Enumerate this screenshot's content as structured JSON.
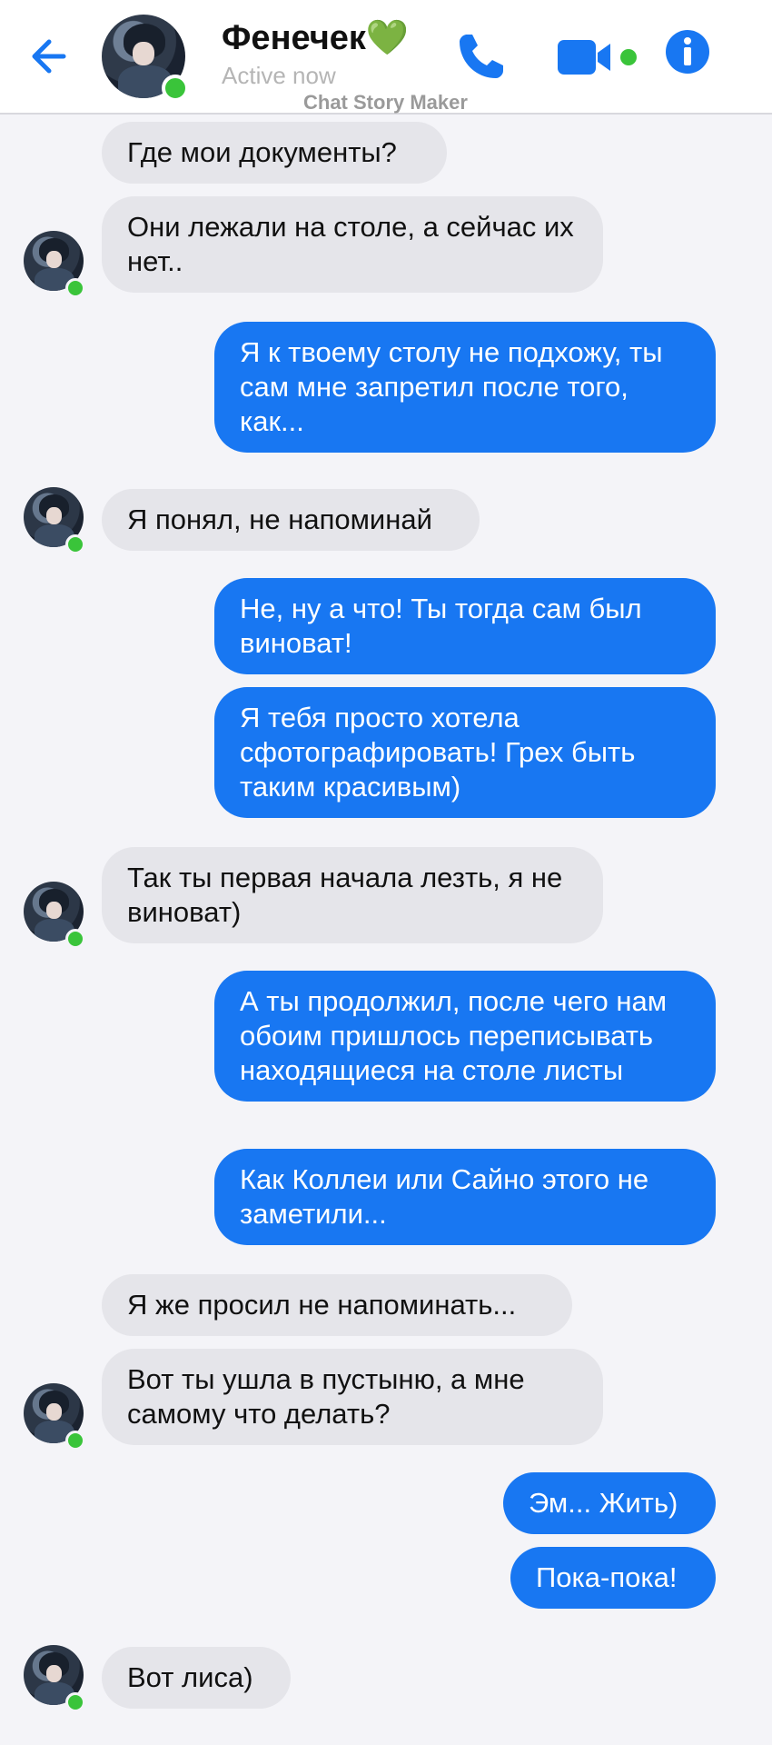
{
  "header": {
    "name": "Фенечек",
    "heart": "💚",
    "status": "Active now",
    "watermark": "Chat Story Maker",
    "accent_color": "#1877f2",
    "online_color": "#3ac43a"
  },
  "messages": [
    {
      "side": "in",
      "text": "Где мои документы?"
    },
    {
      "side": "in",
      "text": "Они лежали на столе, а сейчас их нет.."
    },
    {
      "side": "out",
      "text": "Я к твоему столу не подхожу, ты сам мне запретил после того, как..."
    },
    {
      "side": "in",
      "text": "Я понял, не напоминай"
    },
    {
      "side": "out",
      "text": "Не, ну а что! Ты тогда сам был виноват!"
    },
    {
      "side": "out",
      "text": "Я тебя просто хотела сфотографировать! Грех быть таким красивым)"
    },
    {
      "side": "in",
      "text": "Так ты первая начала лезть, я не виноват)"
    },
    {
      "side": "out",
      "text": "А ты продолжил, после чего нам обоим пришлось переписывать находящиеся на столе листы"
    },
    {
      "side": "out",
      "text": "Как Коллеи или Сайно этого не заметили..."
    },
    {
      "side": "in",
      "text": "Я же просил не напоминать..."
    },
    {
      "side": "in",
      "text": "Вот ты ушла в пустыню, а мне самому что делать?"
    },
    {
      "side": "out",
      "text": "Эм... Жить)"
    },
    {
      "side": "out",
      "text": "Пока-пока!"
    },
    {
      "side": "in",
      "text": "Вот лиса)"
    }
  ]
}
